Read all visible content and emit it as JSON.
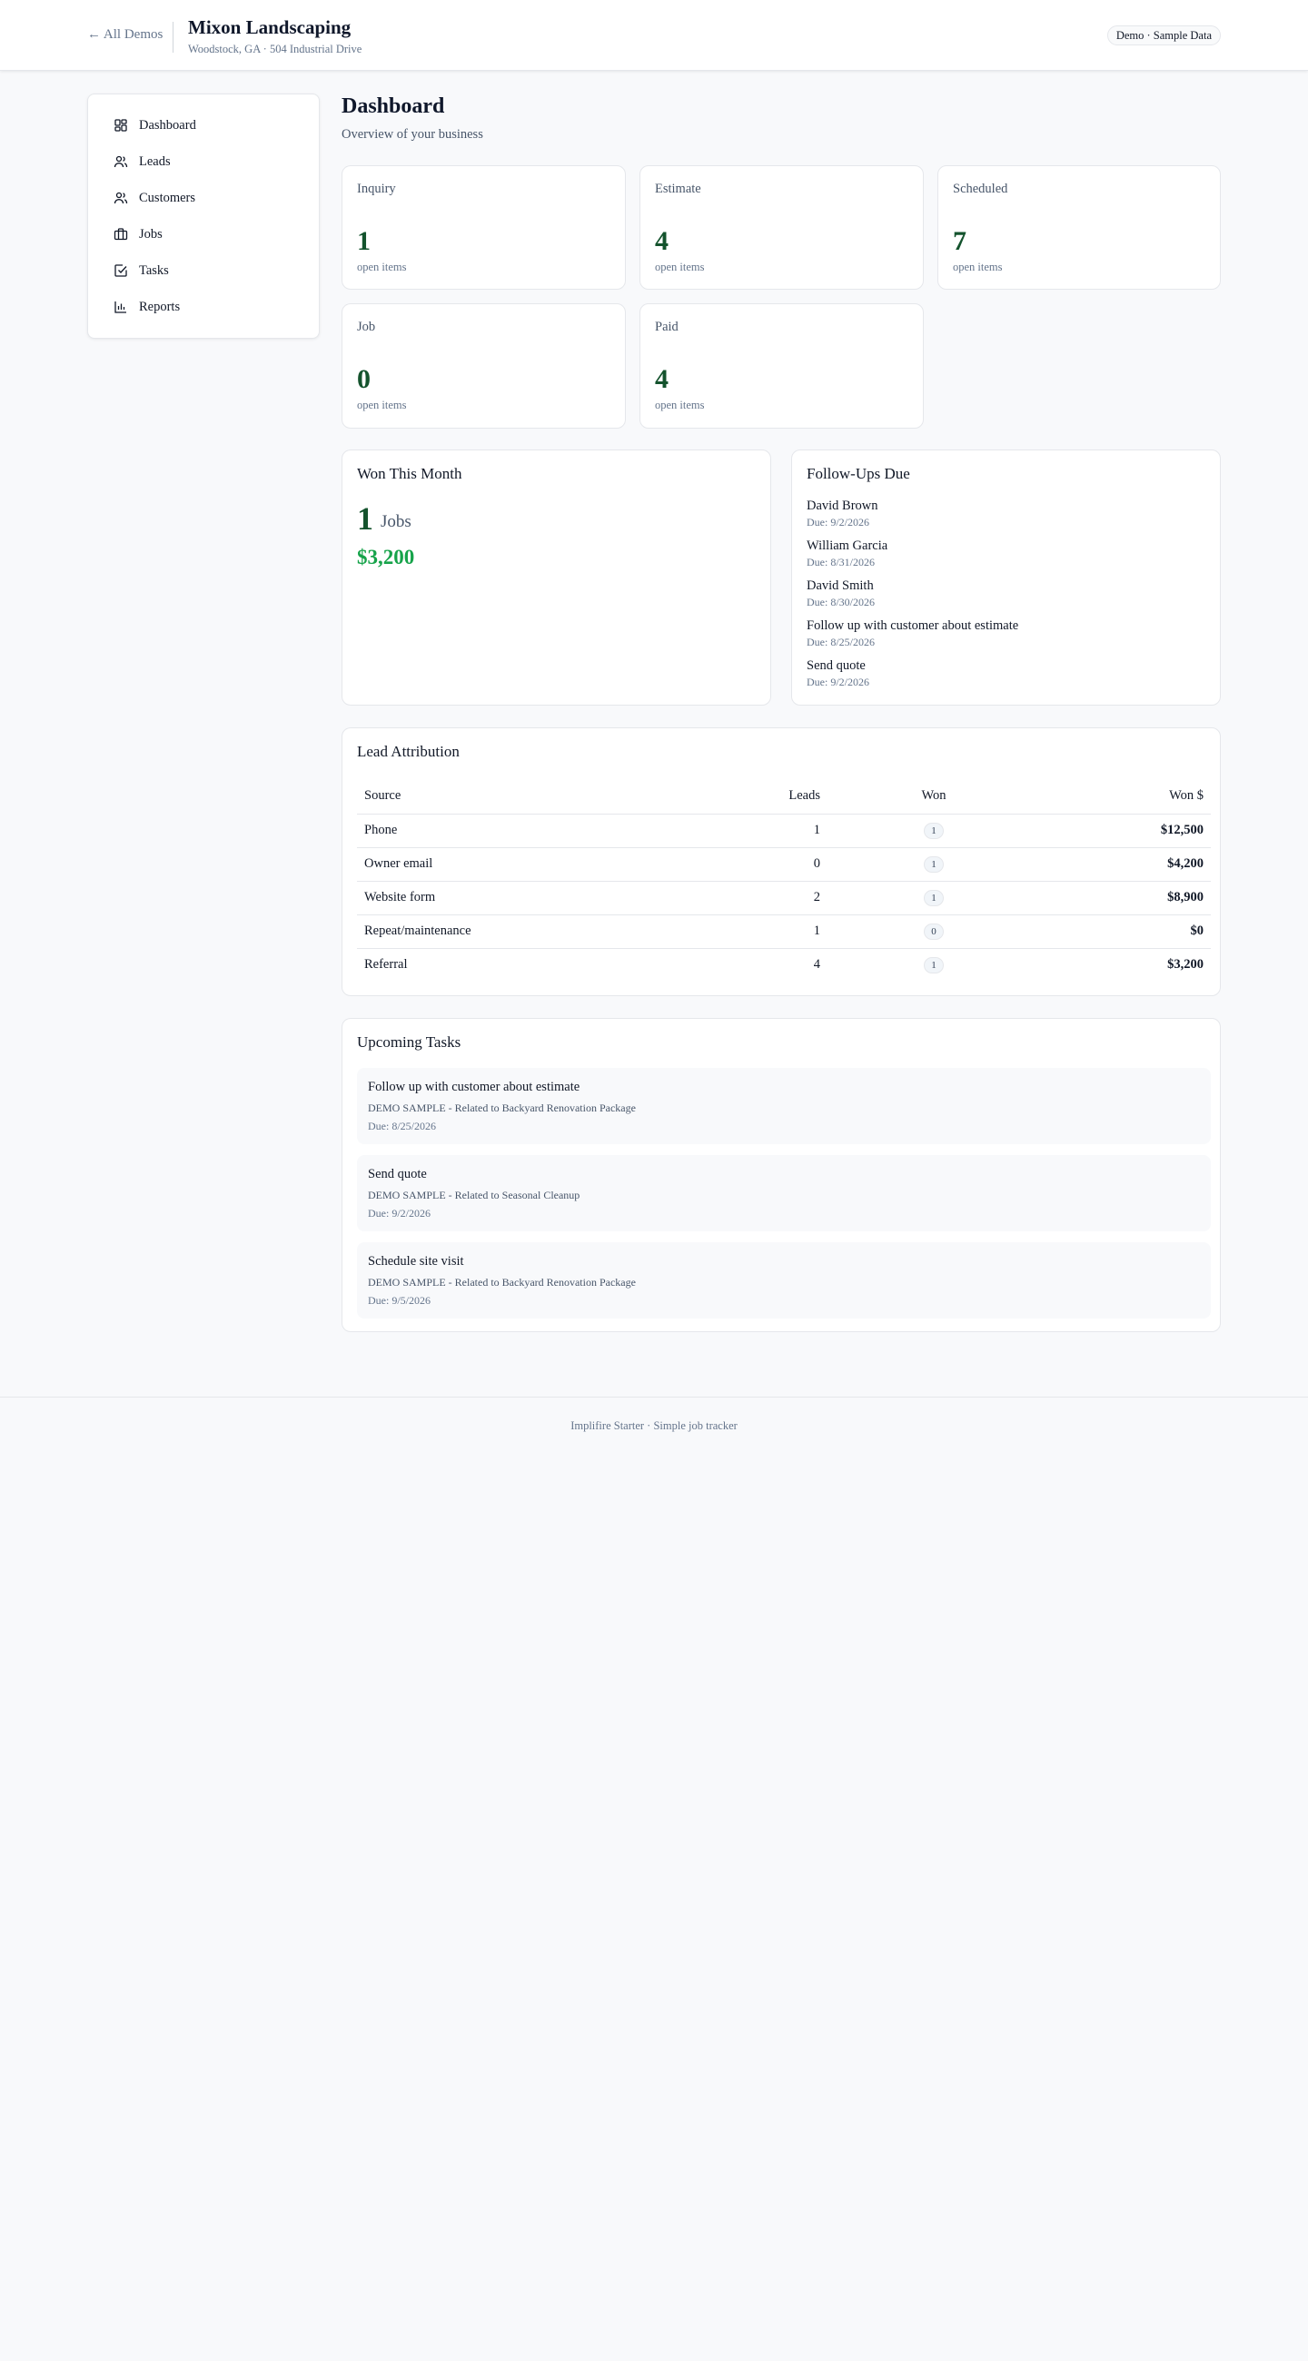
{
  "header": {
    "back_label": "← All Demos",
    "business_name": "Mixon Landscaping",
    "business_location": "Woodstock, GA · 504 Industrial Drive",
    "demo_badge": "Demo · Sample Data"
  },
  "sidebar": {
    "items": [
      {
        "label": "Dashboard",
        "icon": "dashboard-icon"
      },
      {
        "label": "Leads",
        "icon": "users-icon"
      },
      {
        "label": "Customers",
        "icon": "users-icon"
      },
      {
        "label": "Jobs",
        "icon": "briefcase-icon"
      },
      {
        "label": "Tasks",
        "icon": "check-square-icon"
      },
      {
        "label": "Reports",
        "icon": "bar-chart-icon"
      }
    ]
  },
  "page": {
    "title": "Dashboard",
    "subtitle": "Overview of your business"
  },
  "stages": [
    {
      "label": "Inquiry",
      "count": "1",
      "note": "open items"
    },
    {
      "label": "Estimate",
      "count": "4",
      "note": "open items"
    },
    {
      "label": "Scheduled",
      "count": "7",
      "note": "open items"
    },
    {
      "label": "Job",
      "count": "0",
      "note": "open items"
    },
    {
      "label": "Paid",
      "count": "4",
      "note": "open items"
    }
  ],
  "won_month": {
    "title": "Won This Month",
    "count": "1",
    "unit": "Jobs",
    "amount": "$3,200"
  },
  "followups": {
    "title": "Follow-Ups Due",
    "items": [
      {
        "name": "David Brown",
        "due": "Due: 9/2/2026"
      },
      {
        "name": "William Garcia",
        "due": "Due: 8/31/2026"
      },
      {
        "name": "David Smith",
        "due": "Due: 8/30/2026"
      },
      {
        "name": "Follow up with customer about estimate",
        "due": "Due: 8/25/2026"
      },
      {
        "name": "Send quote",
        "due": "Due: 9/2/2026"
      }
    ]
  },
  "attribution": {
    "title": "Lead Attribution",
    "headers": {
      "source": "Source",
      "leads": "Leads",
      "won": "Won",
      "won_amount": "Won $"
    },
    "rows": [
      {
        "source": "Phone",
        "leads": "1",
        "won": "1",
        "won_amount": "$12,500"
      },
      {
        "source": "Owner email",
        "leads": "0",
        "won": "1",
        "won_amount": "$4,200"
      },
      {
        "source": "Website form",
        "leads": "2",
        "won": "1",
        "won_amount": "$8,900"
      },
      {
        "source": "Repeat/maintenance",
        "leads": "1",
        "won": "0",
        "won_amount": "$0"
      },
      {
        "source": "Referral",
        "leads": "4",
        "won": "1",
        "won_amount": "$3,200"
      }
    ]
  },
  "tasks": {
    "title": "Upcoming Tasks",
    "items": [
      {
        "title": "Follow up with customer about estimate",
        "related": "DEMO SAMPLE - Related to Backyard Renovation Package",
        "due": "Due: 8/25/2026"
      },
      {
        "title": "Send quote",
        "related": "DEMO SAMPLE - Related to Seasonal Cleanup",
        "due": "Due: 9/2/2026"
      },
      {
        "title": "Schedule site visit",
        "related": "DEMO SAMPLE - Related to Backyard Renovation Package",
        "due": "Due: 9/5/2026"
      }
    ]
  },
  "footer": {
    "text": "Implifire Starter · Simple job tracker"
  },
  "colors": {
    "accent_dark_green": "#14532d",
    "money_green": "#16a34a",
    "page_background": "#f8f9fb"
  }
}
